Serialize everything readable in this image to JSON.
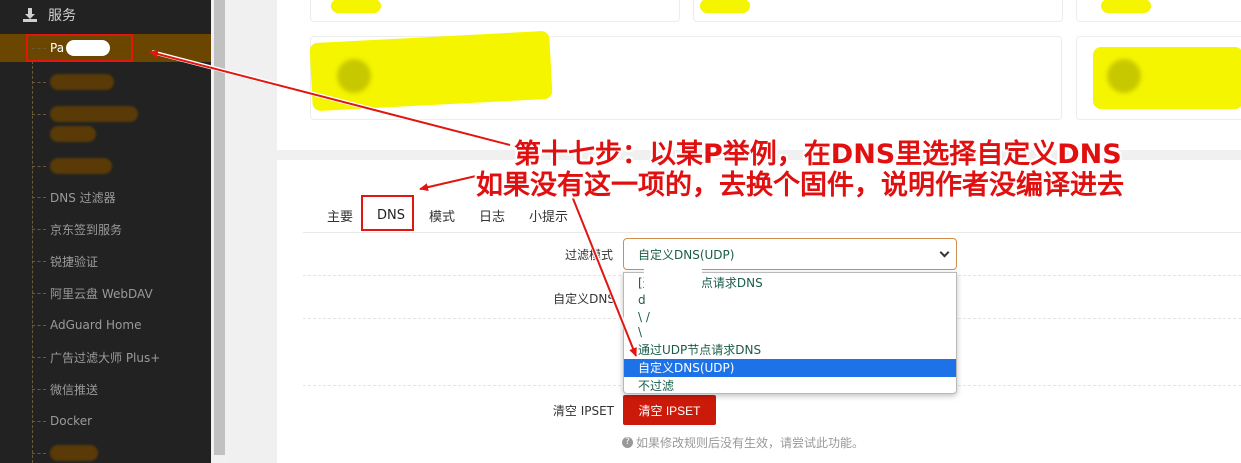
{
  "sidebar": {
    "section_title": "服务",
    "active_item_label": "Pa",
    "items": [
      {
        "label": ""
      },
      {
        "label": ""
      },
      {
        "label": ""
      },
      {
        "label": "DNS 过滤器"
      },
      {
        "label": "京东签到服务"
      },
      {
        "label": "锐捷验证"
      },
      {
        "label": "阿里云盘 WebDAV"
      },
      {
        "label": "AdGuard Home"
      },
      {
        "label": "广告过滤大师 Plus+"
      },
      {
        "label": "微信推送"
      },
      {
        "label": "Docker"
      },
      {
        "label": ""
      }
    ]
  },
  "tabs": [
    "主要",
    "DNS",
    "模式",
    "日志",
    "小提示"
  ],
  "form": {
    "filter_mode_label": "过滤模式",
    "filter_mode_value": "自定义DNS(UDP)",
    "custom_dns_label": "自定义DNS",
    "clear_ipset_label": "清空 IPSET",
    "clear_ipset_button": "清空 IPSET",
    "hint": "如果修改规则后没有生效，请尝试此功能。",
    "hint_icon": "?"
  },
  "dropdown_options": [
    "[通过TCP节点请求DNS",
    "d s",
    "\\ /",
    "\\",
    "通过UDP节点请求DNS",
    "自定义DNS(UDP)",
    "不过滤"
  ],
  "dropdown_selected_index": 5,
  "annotation": {
    "line1": "第十七步：以某P举例，在DNS里选择自定义DNS",
    "line2": "如果没有这一项的，去换个固件，说明作者没编译进去"
  },
  "colors": {
    "sidebar_bg": "#222222",
    "active_item_bg": "#6b4600",
    "accent_red": "#e0160f",
    "button_red": "#cc1a0a",
    "select_border": "#d08f4a",
    "highlight_blue": "#1e72e8"
  },
  "icons": {
    "section": "download-icon",
    "hint": "question-circle-icon",
    "select": "chevron-down-icon"
  }
}
